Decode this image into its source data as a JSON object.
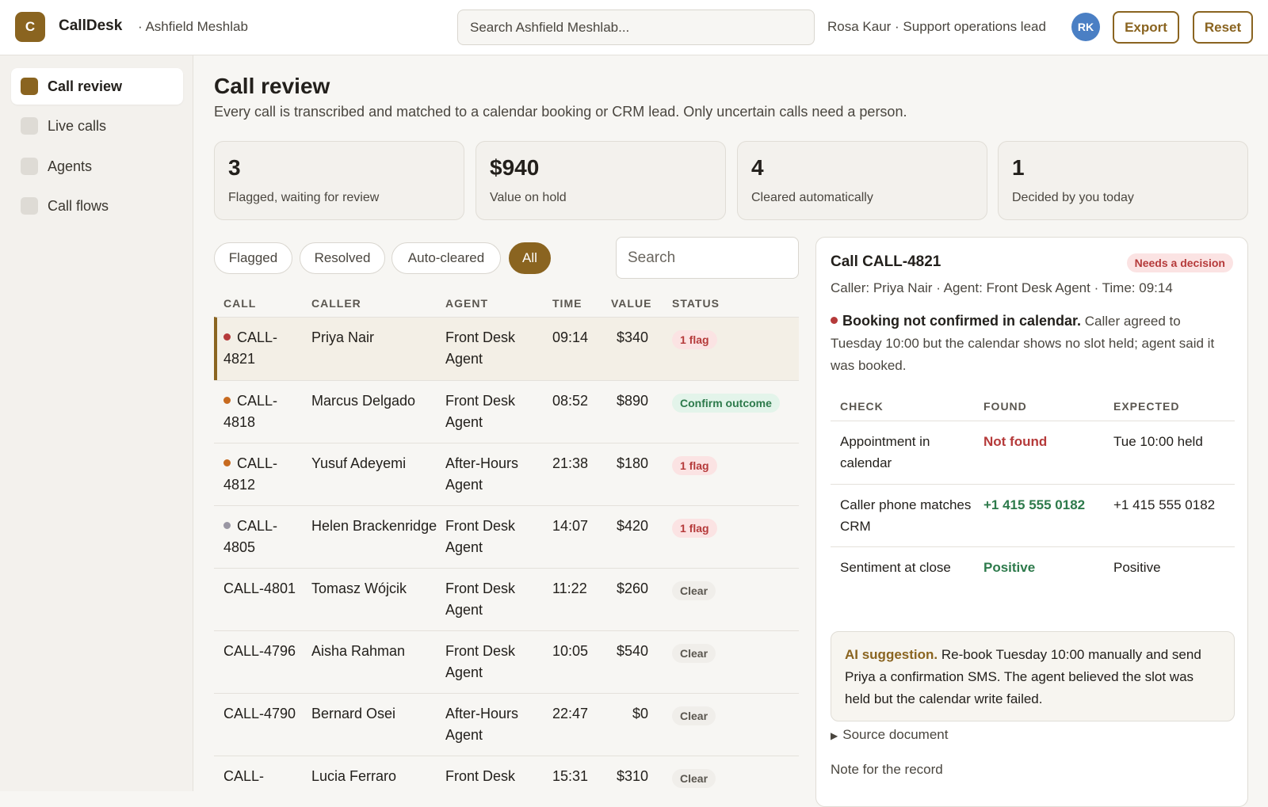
{
  "header": {
    "logo_letter": "C",
    "app_name": "CallDesk",
    "org": "· Ashfield Meshlab",
    "search_placeholder": "Search Ashfield Meshlab...",
    "user": "Rosa Kaur · Support operations lead",
    "avatar_initials": "RK",
    "export_label": "Export",
    "reset_label": "Reset"
  },
  "sidebar": {
    "items": [
      {
        "label": "Call review",
        "active": true
      },
      {
        "label": "Live calls",
        "active": false
      },
      {
        "label": "Agents",
        "active": false
      },
      {
        "label": "Call flows",
        "active": false
      }
    ]
  },
  "page": {
    "title": "Call review",
    "subtitle": "Every call is transcribed and matched to a calendar booking or CRM lead. Only uncertain calls need a person."
  },
  "stats": [
    {
      "value": "3",
      "label": "Flagged, waiting for review"
    },
    {
      "value": "$940",
      "label": "Value on hold"
    },
    {
      "value": "4",
      "label": "Cleared automatically"
    },
    {
      "value": "1",
      "label": "Decided by you today"
    }
  ],
  "filters": [
    {
      "label": "Flagged",
      "active": false
    },
    {
      "label": "Resolved",
      "active": false
    },
    {
      "label": "Auto-cleared",
      "active": false
    },
    {
      "label": "All",
      "active": true
    }
  ],
  "list_search_placeholder": "Search",
  "table": {
    "headers": [
      "CALL",
      "CALLER",
      "AGENT",
      "TIME",
      "VALUE",
      "STATUS"
    ],
    "rows": [
      {
        "call": "CALL-4821",
        "caller": "Priya Nair",
        "agent": "Front Desk Agent",
        "time": "09:14",
        "value": "$340",
        "status": "1 flag",
        "status_kind": "flag",
        "dot_color": "#b53a3a",
        "selected": true
      },
      {
        "call": "CALL-4818",
        "caller": "Marcus Delgado",
        "agent": "Front Desk Agent",
        "time": "08:52",
        "value": "$890",
        "status": "Confirm outcome",
        "status_kind": "confirm",
        "dot_color": "#c76a1f",
        "selected": false
      },
      {
        "call": "CALL-4812",
        "caller": "Yusuf Adeyemi",
        "agent": "After-Hours Agent",
        "time": "21:38",
        "value": "$180",
        "status": "1 flag",
        "status_kind": "flag",
        "dot_color": "#c76a1f",
        "selected": false
      },
      {
        "call": "CALL-4805",
        "caller": "Helen Brackenridge",
        "agent": "Front Desk Agent",
        "time": "14:07",
        "value": "$420",
        "status": "1 flag",
        "status_kind": "flag",
        "dot_color": "#9a97a3",
        "selected": false
      },
      {
        "call": "CALL-4801",
        "caller": "Tomasz Wójcik",
        "agent": "Front Desk Agent",
        "time": "11:22",
        "value": "$260",
        "status": "Clear",
        "status_kind": "clear",
        "dot_color": "",
        "selected": false
      },
      {
        "call": "CALL-4796",
        "caller": "Aisha Rahman",
        "agent": "Front Desk Agent",
        "time": "10:05",
        "value": "$540",
        "status": "Clear",
        "status_kind": "clear",
        "dot_color": "",
        "selected": false
      },
      {
        "call": "CALL-4790",
        "caller": "Bernard Osei",
        "agent": "After-Hours Agent",
        "time": "22:47",
        "value": "$0",
        "status": "Clear",
        "status_kind": "clear",
        "dot_color": "",
        "selected": false
      },
      {
        "call": "CALL-",
        "caller": "Lucia Ferraro",
        "agent": "Front Desk",
        "time": "15:31",
        "value": "$310",
        "status": "Clear",
        "status_kind": "clear",
        "dot_color": "",
        "selected": false
      }
    ]
  },
  "detail": {
    "title": "Call CALL-4821",
    "badge": "Needs a decision",
    "meta": "Caller: Priya Nair · Agent: Front Desk Agent · Time: 09:14",
    "finding_title": "Booking not confirmed in calendar.",
    "finding_text": " Caller agreed to Tuesday 10:00 but the calendar shows no slot held; agent said it was booked.",
    "checks_headers": [
      "CHECK",
      "FOUND",
      "EXPECTED"
    ],
    "checks": [
      {
        "check": "Appointment in calendar",
        "found": "Not found",
        "found_kind": "bad",
        "expected": "Tue 10:00 held"
      },
      {
        "check": "Caller phone matches CRM",
        "found": "+1 415 555 0182",
        "found_kind": "good",
        "expected": "+1 415 555 0182"
      },
      {
        "check": "Sentiment at close",
        "found": "Positive",
        "found_kind": "good",
        "expected": "Positive"
      }
    ],
    "ai_label": "AI suggestion.",
    "ai_text": " Re-book Tuesday 10:00 manually and send Priya a confirmation SMS. The agent believed the slot was held but the calendar write failed.",
    "source_label": "Source document",
    "note_label": "Note for the record"
  }
}
